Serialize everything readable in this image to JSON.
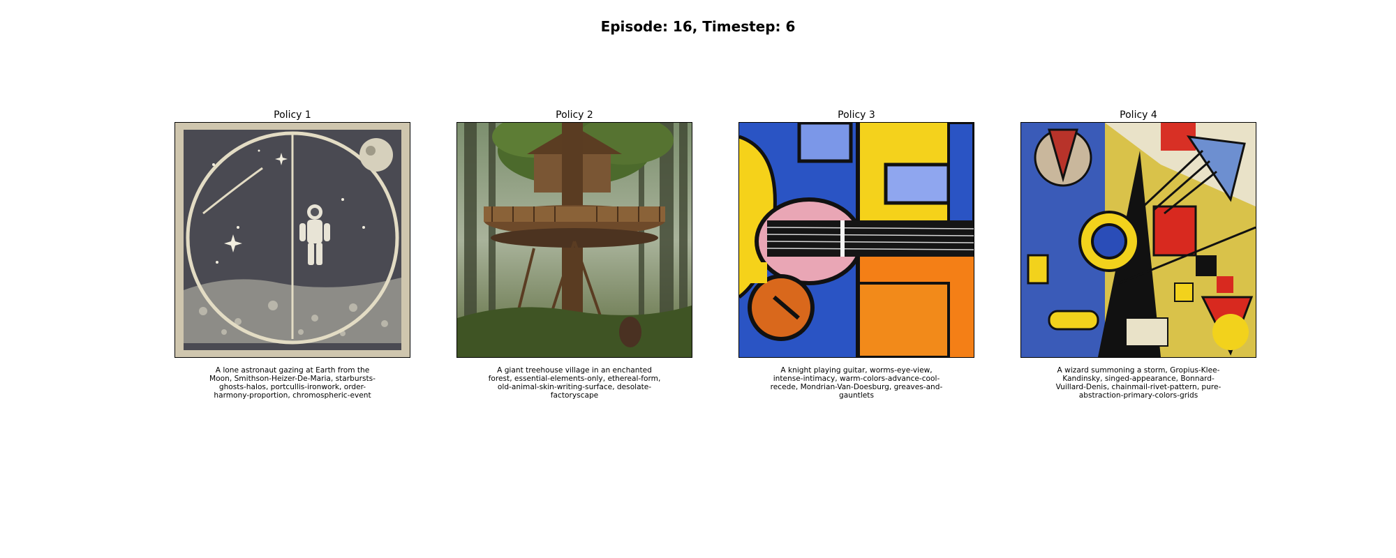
{
  "title": "Episode: 16, Timestep: 6",
  "panels": [
    {
      "label": "Policy 1",
      "caption": "A lone astronaut gazing at Earth from the Moon, Smithson-Heizer-De-Maria, starbursts-ghosts-halos, portcullis-ironwork, order-harmony-proportion, chromospheric-event"
    },
    {
      "label": "Policy 2",
      "caption": "A giant treehouse village in an enchanted forest, essential-elements-only, ethereal-form, old-animal-skin-writing-surface, desolate-factoryscape"
    },
    {
      "label": "Policy 3",
      "caption": "A knight playing guitar, worms-eye-view, intense-intimacy, warm-colors-advance-cool-recede, Mondrian-Van-Doesburg, greaves-and-gauntlets"
    },
    {
      "label": "Policy 4",
      "caption": "A wizard summoning a storm, Gropius-Klee-Kandinsky, singed-appearance, Bonnard-Vuillard-Denis, chainmail-rivet-pattern, pure-abstraction-primary-colors-grids"
    }
  ]
}
